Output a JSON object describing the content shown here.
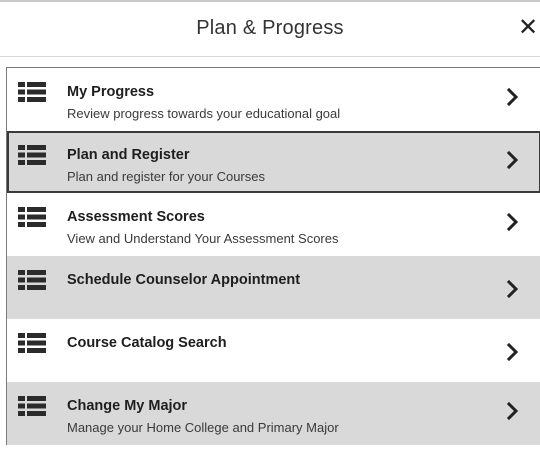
{
  "header": {
    "title": "Plan & Progress",
    "close_glyph": "✕"
  },
  "menu": {
    "items": [
      {
        "title": "My Progress",
        "subtitle": "Review progress towards your educational goal",
        "icon": "list-icon",
        "chevron": "chevron-right-icon",
        "selected": false
      },
      {
        "title": "Plan and Register",
        "subtitle": "Plan and register for your Courses",
        "icon": "list-icon",
        "chevron": "chevron-right-icon",
        "selected": true
      },
      {
        "title": "Assessment Scores",
        "subtitle": "View and Understand Your Assessment Scores",
        "icon": "list-icon",
        "chevron": "chevron-right-icon",
        "selected": false
      },
      {
        "title": "Schedule Counselor Appointment",
        "subtitle": "",
        "icon": "list-icon",
        "chevron": "chevron-right-icon",
        "selected": false
      },
      {
        "title": "Course Catalog Search",
        "subtitle": "",
        "icon": "list-icon",
        "chevron": "chevron-right-icon",
        "selected": false
      },
      {
        "title": "Change My Major",
        "subtitle": "Manage your Home College and Primary Major",
        "icon": "list-icon",
        "chevron": "chevron-right-icon",
        "selected": false
      }
    ]
  },
  "colors": {
    "row_alt": "#d9d9d9",
    "row_white": "#ffffff",
    "text": "#1e1e1e",
    "icon": "#2b2b2b"
  }
}
